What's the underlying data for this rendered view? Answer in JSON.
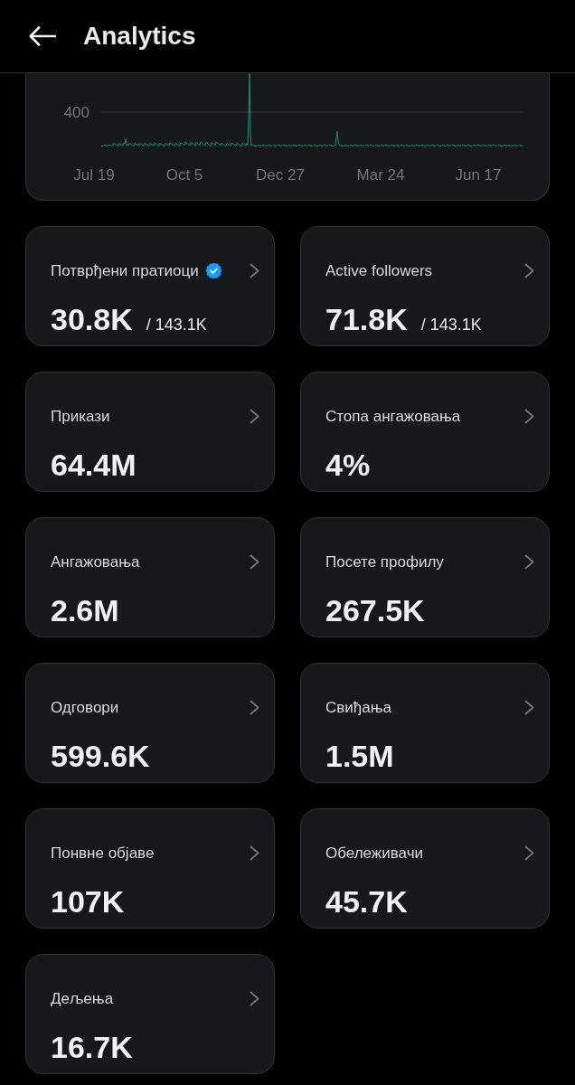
{
  "header": {
    "title": "Analytics"
  },
  "chart": {
    "y_tick_label": "400",
    "x_labels": [
      "Jul 19",
      "Oct 5",
      "Dec 27",
      "Mar 24",
      "Jun 17"
    ]
  },
  "metrics": [
    {
      "label": "Потврђени пратиоци",
      "verified": true,
      "value": "30.8K",
      "total": "/ 143.1K"
    },
    {
      "label": "Active followers",
      "verified": false,
      "value": "71.8K",
      "total": "/ 143.1K"
    },
    {
      "label": "Прикази",
      "verified": false,
      "value": "64.4M"
    },
    {
      "label": "Стопа ангажовања",
      "verified": false,
      "value": "4%"
    },
    {
      "label": "Ангажовања",
      "verified": false,
      "value": "2.6M"
    },
    {
      "label": "Посете профилу",
      "verified": false,
      "value": "267.5K"
    },
    {
      "label": "Одговори",
      "verified": false,
      "value": "599.6K"
    },
    {
      "label": "Свиђања",
      "verified": false,
      "value": "1.5M"
    },
    {
      "label": "Понвне објаве",
      "verified": false,
      "value": "107K"
    },
    {
      "label": "Обележивачи",
      "verified": false,
      "value": "45.7K"
    },
    {
      "label": "Дељења",
      "verified": false,
      "value": "16.7K"
    }
  ]
}
